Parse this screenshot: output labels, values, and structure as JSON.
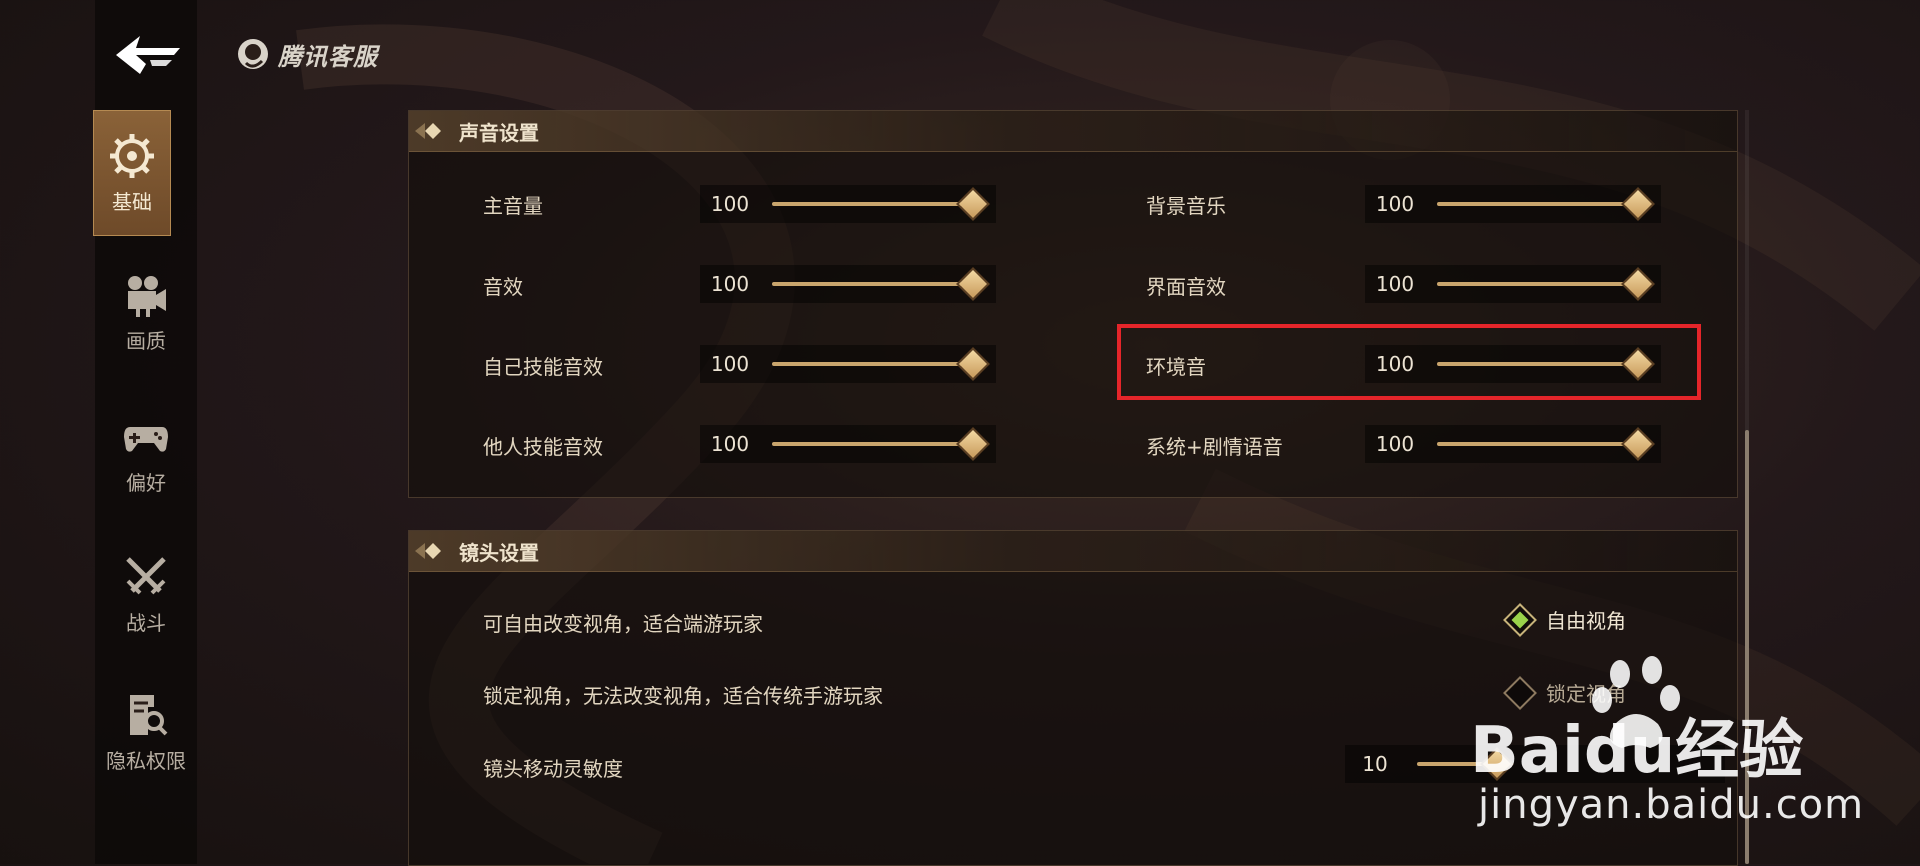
{
  "brand": {
    "name": "腾讯客服"
  },
  "nav": {
    "items": [
      {
        "label": "基础",
        "icon": "gear-icon",
        "active": true
      },
      {
        "label": "画质",
        "icon": "camera-icon",
        "active": false
      },
      {
        "label": "偏好",
        "icon": "gamepad-icon",
        "active": false
      },
      {
        "label": "战斗",
        "icon": "crossed-swords-icon",
        "active": false
      },
      {
        "label": "隐私权限",
        "icon": "privacy-search-icon",
        "active": false
      }
    ]
  },
  "sound": {
    "title": "声音设置",
    "left": [
      {
        "label": "主音量",
        "value": "100"
      },
      {
        "label": "音效",
        "value": "100"
      },
      {
        "label": "自己技能音效",
        "value": "100"
      },
      {
        "label": "他人技能音效",
        "value": "100"
      }
    ],
    "right": [
      {
        "label": "背景音乐",
        "value": "100"
      },
      {
        "label": "界面音效",
        "value": "100"
      },
      {
        "label": "环境音",
        "value": "100"
      },
      {
        "label": "系统+剧情语音",
        "value": "100"
      }
    ]
  },
  "camera": {
    "title": "镜头设置",
    "options": [
      {
        "desc": "可自由改变视角，适合端游玩家",
        "label": "自由视角",
        "selected": true
      },
      {
        "desc": "锁定视角，无法改变视角，适合传统手游玩家",
        "label": "锁定视角",
        "selected": false
      }
    ],
    "sensitivity": {
      "label": "镜头移动灵敏度",
      "value": "10"
    }
  },
  "watermark": {
    "brand": "Baidu经验",
    "url": "jingyan.baidu.com"
  },
  "colors": {
    "accent": "#c9a56d",
    "highlight": "#e5252a",
    "selected": "#9ad34b"
  }
}
